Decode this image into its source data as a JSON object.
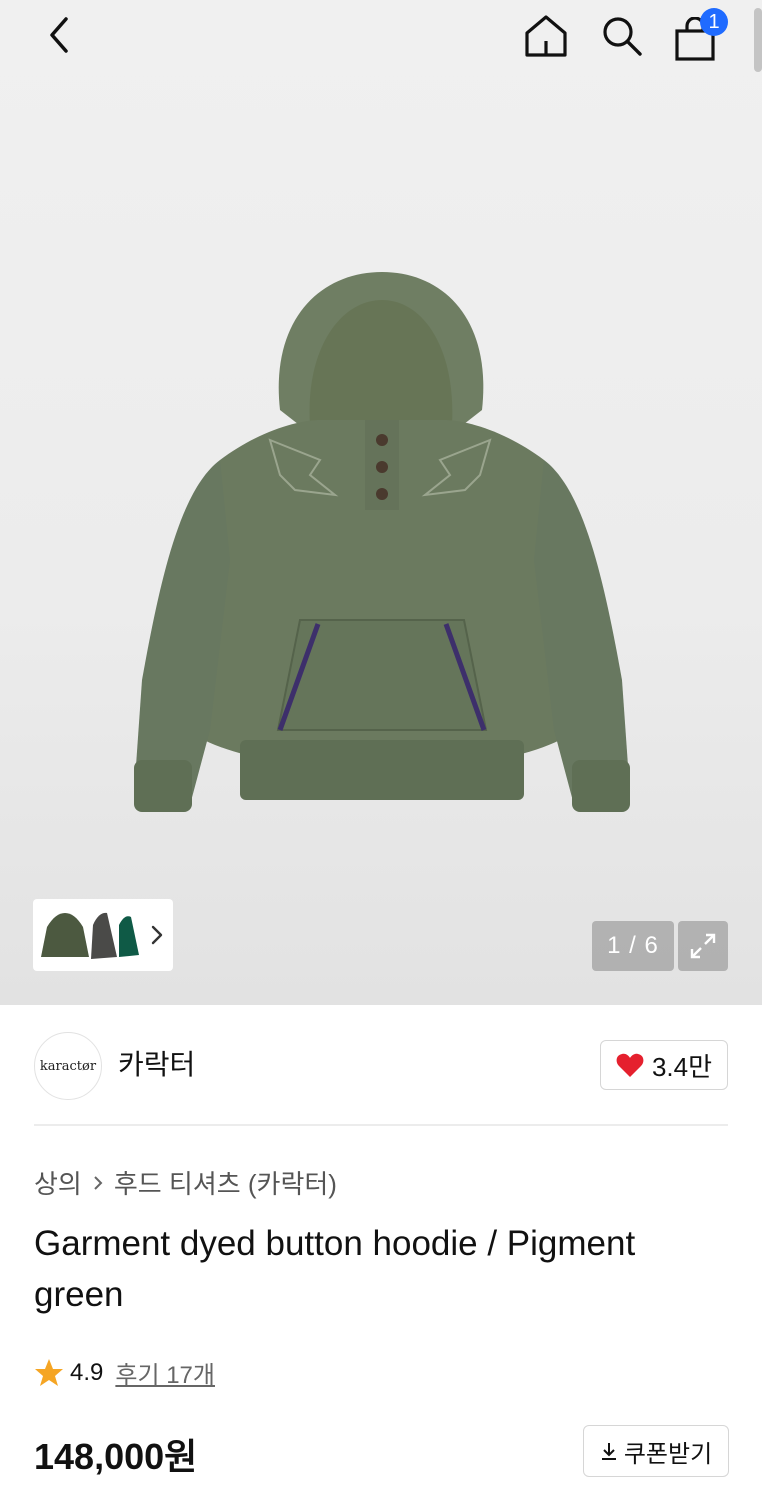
{
  "header": {
    "back_icon": "chevron-left-icon",
    "home_icon": "home-icon",
    "search_icon": "search-icon",
    "cart_icon": "shopping-bag-icon",
    "cart_count": "1"
  },
  "gallery": {
    "counter": "1 / 6",
    "expand_icon": "expand-icon"
  },
  "brand": {
    "logo_text": "karactør",
    "name": "카락터",
    "like_count": "3.4만"
  },
  "breadcrumb": {
    "category": "상의",
    "subcategory": "후드 티셔츠 (카락터)"
  },
  "product": {
    "title": "Garment dyed button hoodie / Pigment green",
    "rating": "4.9",
    "reviews": "후기 17개",
    "price": "148,000원"
  },
  "actions": {
    "coupon_label": "쿠폰받기"
  },
  "colors": {
    "accent_blue": "#1f6bff",
    "heart_red": "#e5202e",
    "star_orange": "#f5a524",
    "hoodie_green": "#6b7a60"
  }
}
